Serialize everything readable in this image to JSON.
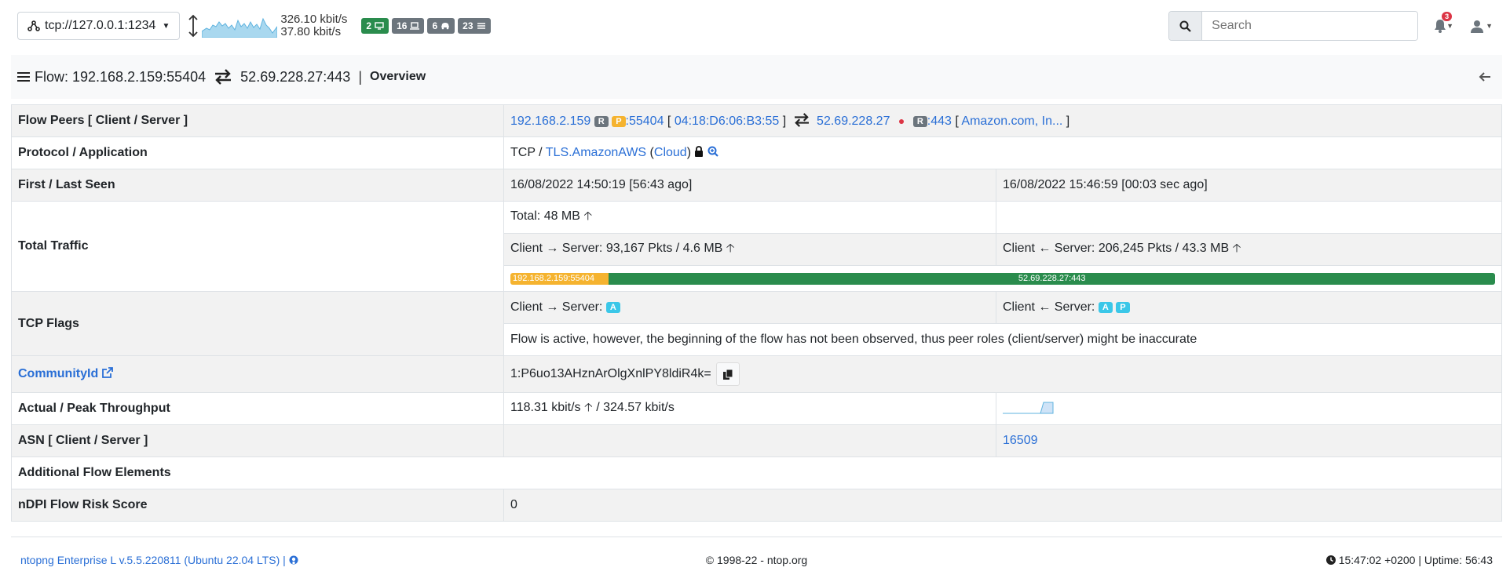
{
  "topbar": {
    "interface": "tcp://127.0.0.1:1234",
    "rate_up": "326.10 kbit/s",
    "rate_down": "37.80 kbit/s",
    "badges": [
      {
        "count": "2",
        "icon": "monitor-icon",
        "color": "#2a8c4d"
      },
      {
        "count": "16",
        "icon": "laptop-icon",
        "color": "#6c757d"
      },
      {
        "count": "6",
        "icon": "car-icon",
        "color": "#6c757d"
      },
      {
        "count": "23",
        "icon": "list-icon",
        "color": "#6c757d"
      }
    ],
    "search_placeholder": "Search",
    "alert_count": "3"
  },
  "header": {
    "flow_label": "Flow: 192.168.2.159:55404",
    "server": "52.69.228.27:443",
    "sep": "|",
    "active_tab": "Overview"
  },
  "rows": {
    "peers": {
      "label": "Flow Peers [ Client / Server ]",
      "client_ip": "192.168.2.159",
      "client_tag_r": "R",
      "client_tag_p": "P",
      "client_port": ":55404",
      "client_mac": "04:18:D6:06:B3:55",
      "server_ip": "52.69.228.27",
      "server_tag_r": "R",
      "server_port": ":443",
      "server_asn_name": "Amazon.com, In..."
    },
    "protocol": {
      "label": "Protocol / Application",
      "l4": "TCP /",
      "app": "TLS.AmazonAWS",
      "category": "Cloud"
    },
    "seen": {
      "label": "First / Last Seen",
      "first": "16/08/2022 14:50:19 [56:43 ago]",
      "last": "16/08/2022 15:46:59 [00:03 sec ago]"
    },
    "traffic": {
      "label": "Total Traffic",
      "total": "Total: 48 MB",
      "cli2srv": "Client → Server: 93,167 Pkts / 4.6 MB",
      "srv2cli": "Client ← Server: 206,245 Pkts / 43.3 MB",
      "bar_client": "192.168.2.159:55404",
      "bar_server": "52.69.228.27:443",
      "client_fraction": 0.1
    },
    "tcp_flags": {
      "label": "TCP Flags",
      "cli2srv": "Client → Server:",
      "cli_flags": [
        "A"
      ],
      "srv2cli": "Client ← Server:",
      "srv_flags": [
        "A",
        "P"
      ],
      "note": "Flow is active, however, the beginning of the flow has not been observed, thus peer roles (client/server) might be inaccurate"
    },
    "community": {
      "label": "CommunityId",
      "value": "1:P6uo13AHznArOlgXnlPY8ldiR4k="
    },
    "throughput": {
      "label": "Actual / Peak Throughput",
      "value": "118.31 kbit/s",
      "peak": "/ 324.57 kbit/s"
    },
    "asn": {
      "label": "ASN [ Client / Server ]",
      "server": "16509"
    },
    "additional": {
      "label": "Additional Flow Elements"
    },
    "risk": {
      "label": "nDPI Flow Risk Score",
      "value": "0"
    }
  },
  "footer": {
    "version": "ntopng Enterprise L v.5.5.220811 (Ubuntu 22.04 LTS) |",
    "copyright": "© 1998-22 - ntop.org",
    "status": "15:47:02 +0200 | Uptime: 56:43"
  }
}
